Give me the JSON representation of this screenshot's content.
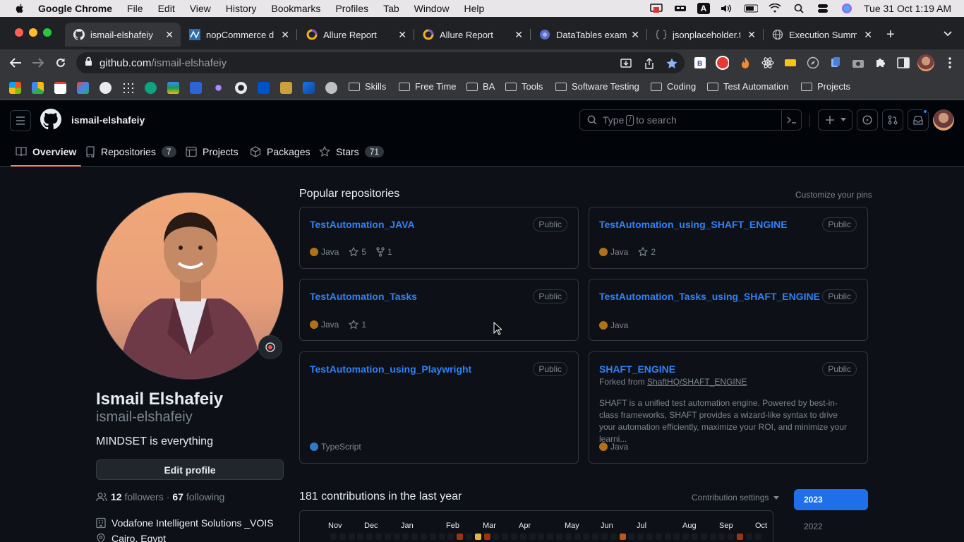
{
  "menubar": {
    "app_name": "Google Chrome",
    "items": [
      "File",
      "Edit",
      "View",
      "History",
      "Bookmarks",
      "Profiles",
      "Tab",
      "Window",
      "Help"
    ],
    "clock": "Tue 31 Oct  1:19 AM",
    "input_indicator": "A"
  },
  "tabs": [
    {
      "title": "ismail-elshafeiy (",
      "icon": "github-icon"
    },
    {
      "title": "nopCommerce de",
      "icon": "nopcommerce-icon"
    },
    {
      "title": "Allure Report",
      "icon": "allure-icon"
    },
    {
      "title": "Allure Report",
      "icon": "allure-icon"
    },
    {
      "title": "DataTables examp",
      "icon": "datatables-icon"
    },
    {
      "title": "jsonplaceholder.t",
      "icon": "jsonplaceholder-icon"
    },
    {
      "title": "Execution Summ",
      "icon": "globe-icon"
    }
  ],
  "address": {
    "host": "github.com",
    "path": "/ismail-elshafeiy"
  },
  "bookmarks": [
    "Skills",
    "Free Time",
    "BA",
    "Tools",
    "Software Testing",
    "Coding",
    "Test Automation",
    "Projects"
  ],
  "github": {
    "username": "ismail-elshafeiy",
    "search_placeholder_pre": "Type",
    "search_key": "/",
    "search_placeholder_post": "to search",
    "nav": {
      "overview": "Overview",
      "repositories": "Repositories",
      "repositories_count": "7",
      "projects": "Projects",
      "packages": "Packages",
      "stars": "Stars",
      "stars_count": "71"
    }
  },
  "profile": {
    "full_name": "Ismail Elshafeiy",
    "login": "ismail-elshafeiy",
    "bio": "MINDSET is everything",
    "edit_label": "Edit profile",
    "followers_count": "12",
    "followers_label": "followers",
    "separator": "·",
    "following_count": "67",
    "following_label": "following",
    "company": "Vodafone Intelligent Solutions _VOIS",
    "location": "Cairo, Egypt"
  },
  "popular": {
    "title": "Popular repositories",
    "customize": "Customize your pins",
    "public_label": "Public",
    "repos": [
      {
        "name": "TestAutomation_JAVA",
        "lang": "Java",
        "lang_color": "#b07219",
        "stars": "5",
        "forks": "1"
      },
      {
        "name": "TestAutomation_using_SHAFT_ENGINE",
        "lang": "Java",
        "lang_color": "#b07219",
        "stars": "2"
      },
      {
        "name": "TestAutomation_Tasks",
        "lang": "Java",
        "lang_color": "#b07219",
        "stars": "1"
      },
      {
        "name": "TestAutomation_Tasks_using_SHAFT_ENGINE",
        "lang": "Java",
        "lang_color": "#b07219"
      },
      {
        "name": "TestAutomation_using_Playwright",
        "lang": "TypeScript",
        "lang_color": "#3178c6"
      },
      {
        "name": "SHAFT_ENGINE",
        "forked_prefix": "Forked from",
        "forked_from": "ShaftHQ/SHAFT_ENGINE",
        "description": "SHAFT is a unified test automation engine. Powered by best-in-class frameworks, SHAFT provides a wizard-like syntax to drive your automation efficiently, maximize your ROI, and minimize your learni...",
        "lang": "Java",
        "lang_color": "#b07219"
      }
    ]
  },
  "contributions": {
    "title": "181 contributions in the last year",
    "settings": "Contribution settings",
    "months": [
      "Nov",
      "Dec",
      "Jan",
      "Feb",
      "Mar",
      "Apr",
      "May",
      "Jun",
      "Jul",
      "Aug",
      "Sep",
      "Oct"
    ],
    "years": [
      "2023",
      "2022"
    ],
    "selected_year": "2023"
  }
}
